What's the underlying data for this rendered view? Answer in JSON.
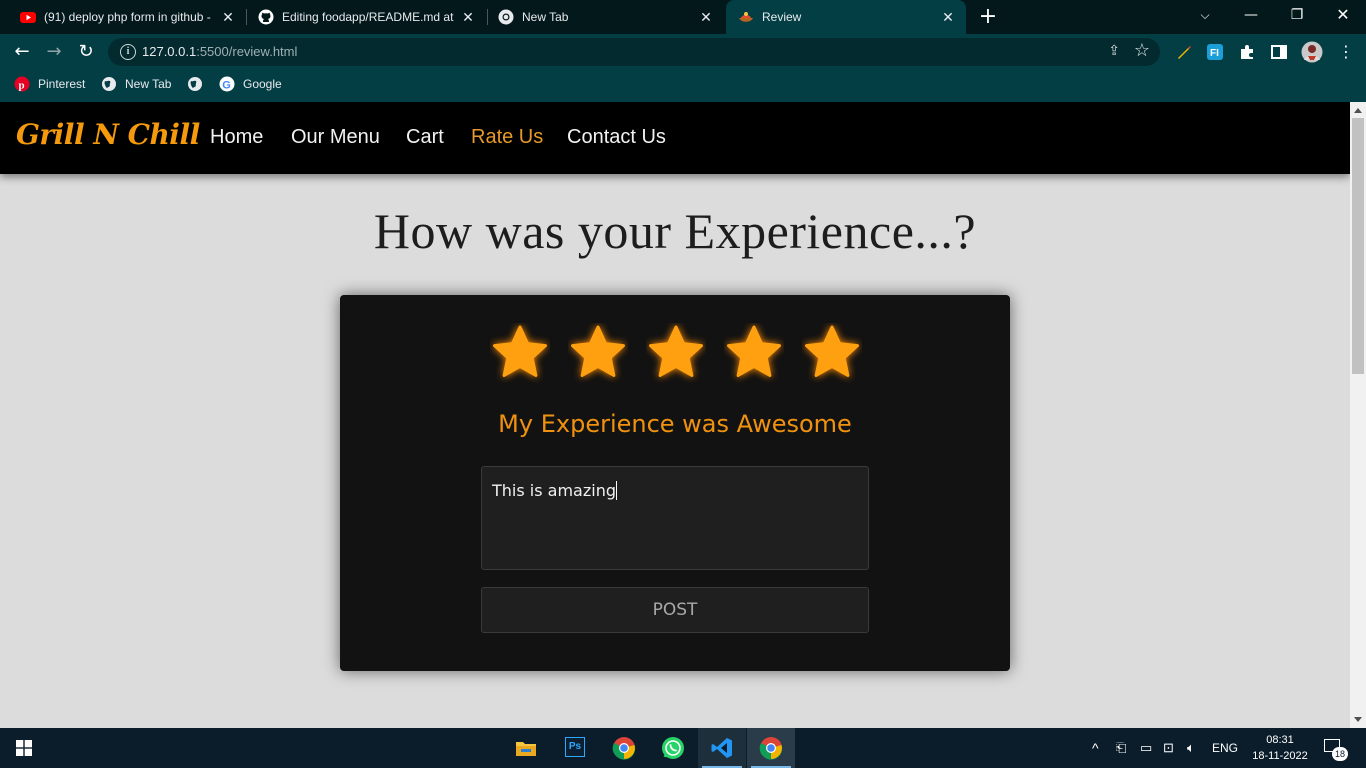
{
  "browser": {
    "tabs": [
      {
        "title": "(91) deploy php form in github -",
        "icon": "youtube-icon"
      },
      {
        "title": "Editing foodapp/README.md at",
        "icon": "github-icon"
      },
      {
        "title": "New Tab",
        "icon": "chrome-icon"
      },
      {
        "title": "Review",
        "icon": "site-favicon",
        "active": true
      }
    ],
    "url_host": "127.0.0.1",
    "url_path": ":5500/review.html",
    "bookmarks": [
      {
        "label": "Pinterest",
        "icon": "pinterest-icon"
      },
      {
        "label": "New Tab",
        "icon": "globe-icon"
      },
      {
        "label": "",
        "icon": "globe-icon"
      },
      {
        "label": "Google",
        "icon": "google-icon"
      }
    ]
  },
  "site": {
    "logo": "Grill N Chill",
    "nav": [
      {
        "label": "Home"
      },
      {
        "label": "Our Menu"
      },
      {
        "label": "Cart"
      },
      {
        "label": "Rate Us",
        "active": true
      },
      {
        "label": "Contact Us"
      }
    ],
    "heading": "How was your Experience...?",
    "rating": {
      "value": 5,
      "max": 5
    },
    "experience_text": "My Experience was Awesome",
    "review_text": "This is amazing",
    "post_label": "POST"
  },
  "taskbar": {
    "apps": [
      "file-explorer-icon",
      "photoshop-icon",
      "chrome-icon",
      "whatsapp-icon",
      "vscode-icon",
      "chrome-icon"
    ],
    "ps_label": "Ps",
    "language": "ENG",
    "time": "08:31",
    "date": "18-11-2022",
    "notifications": "18"
  },
  "colors": {
    "accent": "#f59a0c",
    "chrome_bg": "#033e45",
    "tabstrip_bg": "#03181b",
    "card_bg": "#121212",
    "page_bg": "#dcdcdc"
  }
}
